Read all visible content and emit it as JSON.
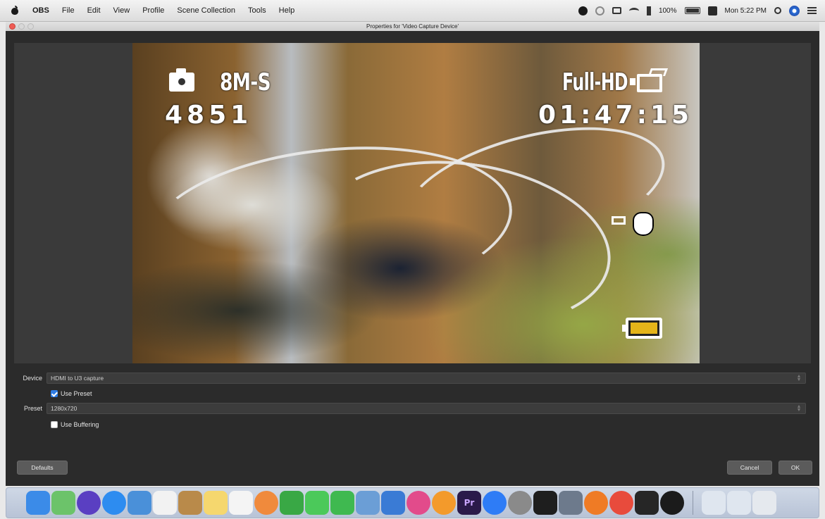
{
  "menubar": {
    "app_name": "OBS",
    "items": [
      "File",
      "Edit",
      "View",
      "Profile",
      "Scene Collection",
      "Tools",
      "Help"
    ],
    "status": {
      "battery_text": "100%",
      "clock": "Mon 5:22 PM"
    }
  },
  "window": {
    "title": "Properties for 'Video Capture Device'"
  },
  "preview": {
    "osd_mode": "8M-S",
    "osd_shot_count": "4851",
    "osd_quality": "Full-HD",
    "osd_timecode": "01:47:15"
  },
  "properties": {
    "device_label": "Device",
    "device_value": "HDMI to U3 capture",
    "use_preset_label": "Use Preset",
    "use_preset_checked": true,
    "preset_label": "Preset",
    "preset_value": "1280x720",
    "use_buffering_label": "Use Buffering",
    "use_buffering_checked": false
  },
  "buttons": {
    "defaults": "Defaults",
    "cancel": "Cancel",
    "ok": "OK"
  },
  "dock": {
    "icons": [
      {
        "name": "finder-icon",
        "color": "#3b8be8"
      },
      {
        "name": "maps-icon",
        "color": "#6cc36a"
      },
      {
        "name": "siri-icon",
        "color": "#5a3fc2"
      },
      {
        "name": "safari-icon",
        "color": "#2d8cf0"
      },
      {
        "name": "photo-icon",
        "color": "#4a90d9"
      },
      {
        "name": "calendar-icon",
        "color": "#f2f2f2"
      },
      {
        "name": "contacts-icon",
        "color": "#b98a4a"
      },
      {
        "name": "notes-icon",
        "color": "#f5d76e"
      },
      {
        "name": "reminders-icon",
        "color": "#f4f4f4"
      },
      {
        "name": "photos-icon",
        "color": "#f08a3c"
      },
      {
        "name": "numbers-icon",
        "color": "#39a845"
      },
      {
        "name": "messages-icon",
        "color": "#4bc95a"
      },
      {
        "name": "facetime-icon",
        "color": "#3fb950"
      },
      {
        "name": "preview-icon",
        "color": "#6b9ed6"
      },
      {
        "name": "keynote-icon",
        "color": "#3a7bd5"
      },
      {
        "name": "itunes-icon",
        "color": "#e24b8b"
      },
      {
        "name": "ibooks-icon",
        "color": "#f39a2b"
      },
      {
        "name": "premiere-icon",
        "color": "#2a1a4a",
        "label": "Pr"
      },
      {
        "name": "appstore-icon",
        "color": "#2e7cf6"
      },
      {
        "name": "system-preferences-icon",
        "color": "#8a8a8a"
      },
      {
        "name": "terminal-icon",
        "color": "#1e1e1e"
      },
      {
        "name": "migration-icon",
        "color": "#6d7a8c"
      },
      {
        "name": "firefox-icon",
        "color": "#ef7b25"
      },
      {
        "name": "chrome-icon",
        "color": "#e84b3c"
      },
      {
        "name": "console-icon",
        "color": "#262626"
      },
      {
        "name": "obs-icon",
        "color": "#1b1b1b"
      }
    ],
    "right_icons": [
      {
        "name": "documents-folder-icon",
        "color": "#dfe6ef"
      },
      {
        "name": "downloads-folder-icon",
        "color": "#dfe6ef"
      },
      {
        "name": "trash-icon",
        "color": "#e5e9ee"
      }
    ]
  }
}
